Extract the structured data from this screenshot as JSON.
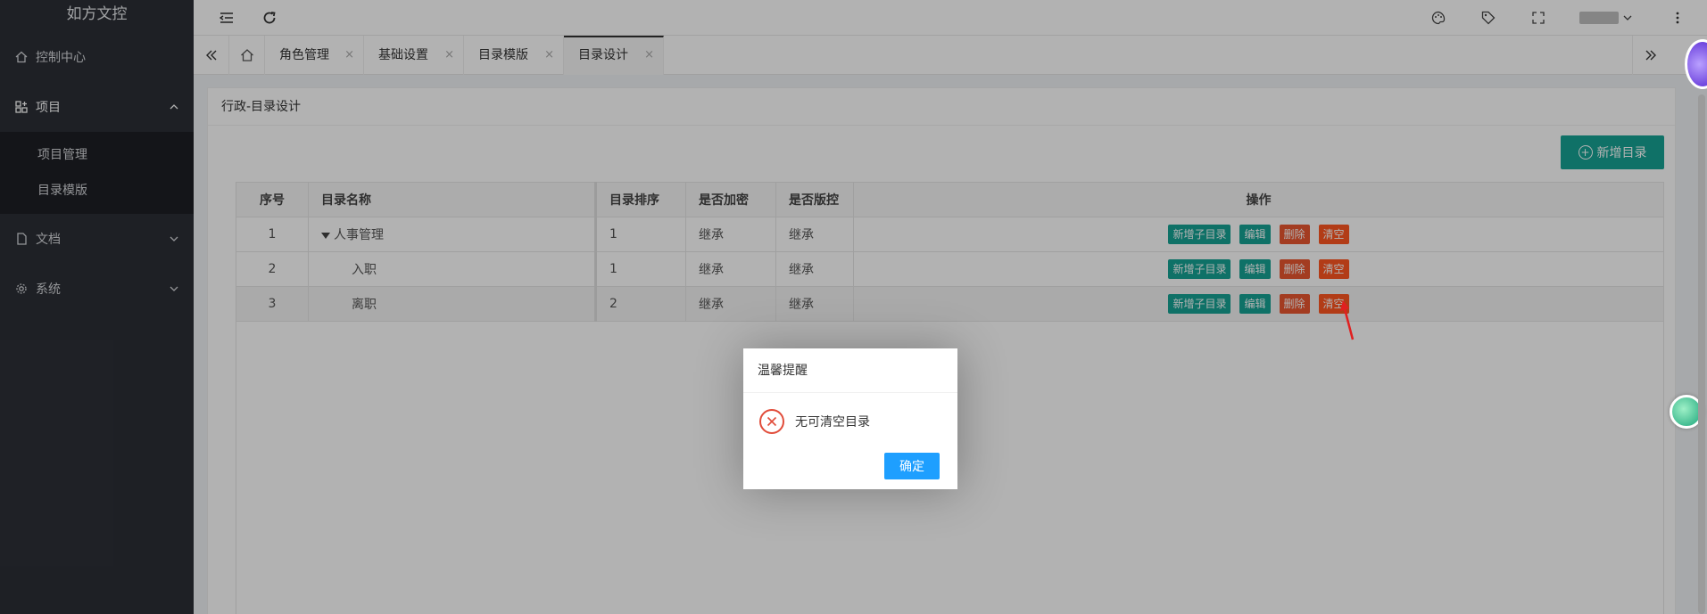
{
  "app": {
    "title": "如方文控"
  },
  "sidebar": {
    "items": [
      {
        "label": "控制中心",
        "icon": "home-icon"
      },
      {
        "label": "项目",
        "icon": "grid-icon",
        "expanded": true,
        "children": [
          {
            "label": "项目管理"
          },
          {
            "label": "目录模版"
          }
        ]
      },
      {
        "label": "文档",
        "icon": "file-icon"
      },
      {
        "label": "系统",
        "icon": "gear-icon"
      }
    ]
  },
  "header": {
    "icons": [
      "menu-fold-icon",
      "refresh-icon",
      "palette-icon",
      "tag-icon",
      "fullscreen-icon",
      "more-icon"
    ]
  },
  "tabs": {
    "items": [
      {
        "label": "角色管理"
      },
      {
        "label": "基础设置"
      },
      {
        "label": "目录模版"
      },
      {
        "label": "目录设计",
        "active": true
      }
    ],
    "close_glyph": "×"
  },
  "page": {
    "card_title": "行政-目录设计",
    "add_button": "新增目录"
  },
  "table": {
    "headers": [
      "序号",
      "目录名称",
      "目录排序",
      "是否加密",
      "是否版控",
      "操作"
    ],
    "rows": [
      {
        "index": "1",
        "name": "人事管理",
        "sort": "1",
        "encrypt": "继承",
        "version": "继承"
      },
      {
        "index": "2",
        "name": "入职",
        "sort": "1",
        "encrypt": "继承",
        "version": "继承"
      },
      {
        "index": "3",
        "name": "离职",
        "sort": "2",
        "encrypt": "继承",
        "version": "继承"
      }
    ],
    "ops": {
      "add_child": "新增子目录",
      "edit": "编辑",
      "delete": "删除",
      "clear": "清空"
    }
  },
  "dialog": {
    "title": "温馨提醒",
    "message": "无可清空目录",
    "ok": "确定"
  },
  "colors": {
    "sidebar": "#2c2f36",
    "accent": "#16a394",
    "danger": "#ea5630",
    "primary": "#1e9fff"
  }
}
